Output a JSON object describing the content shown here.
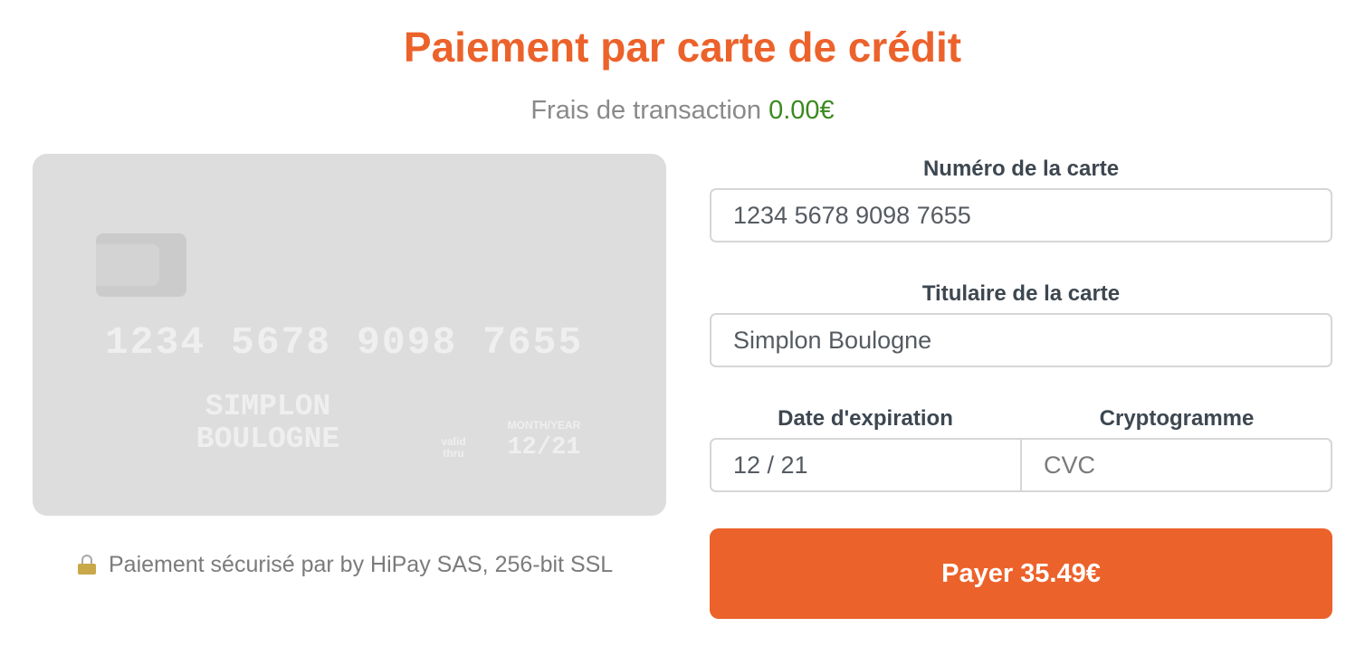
{
  "header": {
    "title": "Paiement par carte de crédit",
    "fee_label": "Frais de transaction",
    "fee_amount": "0.00€"
  },
  "card_preview": {
    "number": "1234 5678 9098 7655",
    "holder_line1": "SIMPLON",
    "holder_line2": "BOULOGNE",
    "valid_thru_line1": "valid",
    "valid_thru_line2": "thru",
    "expiry_label": "MONTH/YEAR",
    "expiry": "12/21"
  },
  "security": {
    "icon": "lock-icon",
    "text": "Paiement sécurisé par by HiPay SAS, 256-bit SSL"
  },
  "form": {
    "card_number_label": "Numéro de la carte",
    "card_number_value": "1234 5678 9098 7655",
    "card_holder_label": "Titulaire de la carte",
    "card_holder_value": "Simplon Boulogne",
    "expiry_label": "Date d'expiration",
    "expiry_value": "12 / 21",
    "cvc_label": "Cryptogramme",
    "cvc_placeholder": "CVC",
    "pay_button_label": "Payer 35.49€"
  },
  "colors": {
    "accent": "#ec622b",
    "fee_amount": "#3c8a1e",
    "card_background": "#dddddd"
  }
}
